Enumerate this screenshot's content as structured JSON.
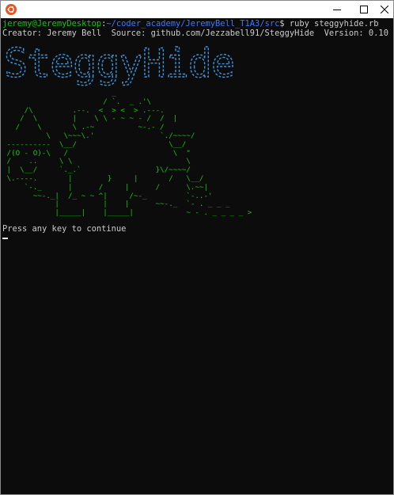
{
  "window": {
    "icon": "ubuntu-icon",
    "controls": [
      "minimize-icon",
      "maximize-icon",
      "close-icon"
    ]
  },
  "colors": {
    "background": "#0c0c0c",
    "prompt_user": "#16c60c",
    "prompt_path": "#3b78ff",
    "banner": "#3a96dd",
    "art": "#16c60c",
    "text": "#cccccc"
  },
  "terminal": {
    "prompt_user": "jeremy@JeremyDesktop",
    "prompt_sep": ":",
    "prompt_path": "~/coder_academy/JeremyBell_T1A3/src",
    "prompt_symbol": "$ ",
    "command": "ruby steggyhide.rb",
    "info_line": "Creator: Jeremy Bell  Source: github.com/Jezzabell91/SteggyHide  Version: 0.10",
    "banner_text": "SteggyHide",
    "stego_art": [
      "                         _                 ",
      "                       / `.  _ .'\\        ",
      "     /\\         .--.  <  > <  > .---.      ",
      "    /  \\        |    \\ \\ - ~ ~ - /  /  |     ",
      "   /    \\       \\ .-~          ~-.- /     ",
      "          \\   \\~~~\\.'               `./~~~~/",
      " ----------  \\__/                     \\__/   ",
      " /(O - O)-\\   /                        \\  \"  ",
      " /    ..     \\ \\                          \\   ",
      " |  \\__/     `._.`                 }\\/~~~~/",
      " \\.----.       |        }     |       /   \\__/ ",
      "     `-._      |      /     |      /      \\.~~| ",
      "       ~~-._|  /_ ~ ~ ^|     /~-_         `-..-'",
      "            |          |    |      ~~-._  `- . _ _ _",
      "            |_____|    |_____|            ~ - . _ _ _ _ >"
    ],
    "continue_text": "Press any key to continue"
  }
}
